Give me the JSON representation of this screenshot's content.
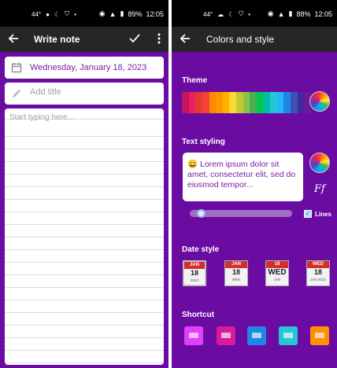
{
  "left": {
    "status": {
      "temp": "44°",
      "battery": "89%",
      "time": "12:05"
    },
    "appbar": {
      "title": "Write note"
    },
    "date": "Wednesday, January 18, 2023",
    "title_placeholder": "Add title",
    "body_placeholder": "Start typing here..."
  },
  "right": {
    "status": {
      "temp": "44°",
      "battery": "88%",
      "time": "12:05"
    },
    "appbar": {
      "title": "Colors and style"
    },
    "theme": {
      "label": "Theme",
      "colors": [
        "#c2185b",
        "#e91e63",
        "#e53935",
        "#f44336",
        "#fb8c00",
        "#ff9800",
        "#ffb300",
        "#fdd835",
        "#c0ca33",
        "#8bc34a",
        "#4caf50",
        "#00c853",
        "#00bfa5",
        "#26c6da",
        "#29b6f6",
        "#1e88e5",
        "#3f51b5",
        "#4527a0",
        "#6a1b9a"
      ]
    },
    "text_styling": {
      "label": "Text styling",
      "preview": "😀 Lorem ipsum dolor sit amet, consectetur elit, sed do eiusmod tempor...",
      "font_icon": "Ff",
      "lines_label": "Lines",
      "lines_checked": true
    },
    "date_style": {
      "label": "Date style",
      "options": [
        {
          "month": "JAN",
          "day": "18",
          "sub": "2023"
        },
        {
          "month": "JAN",
          "day": "18",
          "sub": "WED"
        },
        {
          "month": "18",
          "day": "WED",
          "sub": "JAN"
        },
        {
          "month": "WED",
          "day": "18",
          "sub": "JAN 2023"
        }
      ]
    },
    "shortcut": {
      "label": "Shortcut",
      "colors": [
        "#e040fb",
        "#d81b9a",
        "#1e88e5",
        "#26c6da",
        "#ff8f00"
      ]
    }
  }
}
